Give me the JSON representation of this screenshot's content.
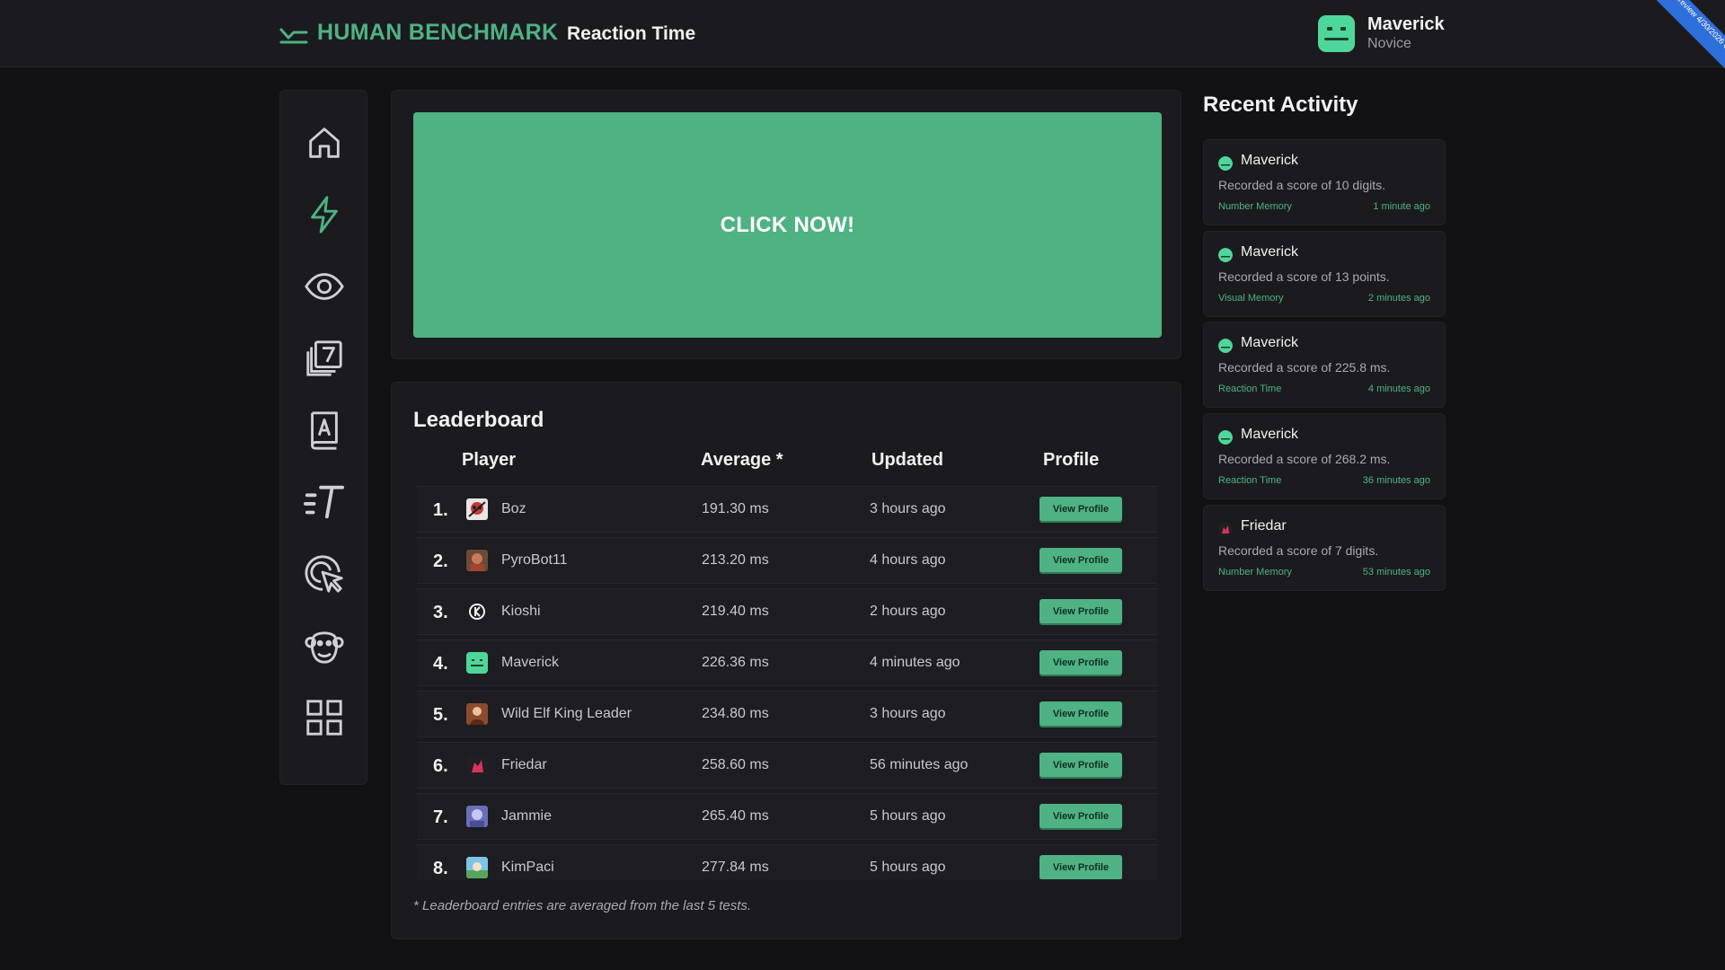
{
  "header": {
    "logo_text": "HUMAN BENCHMARK",
    "page_title": "Reaction Time",
    "user_name": "Maverick",
    "user_rank": "Novice",
    "ribbon_text": "dev preview 4/30/2026 0.1"
  },
  "nav": {
    "items": [
      "home-icon",
      "lightning-icon",
      "eye-icon",
      "number-memory-icon",
      "verbal-memory-icon",
      "typing-icon",
      "aim-icon",
      "chimp-icon",
      "grid-icon"
    ],
    "active_item": "lightning-icon"
  },
  "test": {
    "prompt": "CLICK NOW!"
  },
  "leaderboard": {
    "title": "Leaderboard",
    "columns": [
      "Player",
      "Average *",
      "Updated",
      "Profile"
    ],
    "button_label": "View Profile",
    "rows": [
      {
        "rank": "1.",
        "name": "Boz",
        "average": "191.30 ms",
        "updated": "3 hours ago"
      },
      {
        "rank": "2.",
        "name": "PyroBot11",
        "average": "213.20 ms",
        "updated": "4 hours ago"
      },
      {
        "rank": "3.",
        "name": "Kioshi",
        "average": "219.40 ms",
        "updated": "2 hours ago"
      },
      {
        "rank": "4.",
        "name": "Maverick",
        "average": "226.36 ms",
        "updated": "4 minutes ago"
      },
      {
        "rank": "5.",
        "name": "Wild Elf King Leader",
        "average": "234.80 ms",
        "updated": "3 hours ago"
      },
      {
        "rank": "6.",
        "name": "Friedar",
        "average": "258.60 ms",
        "updated": "56 minutes ago"
      },
      {
        "rank": "7.",
        "name": "Jammie",
        "average": "265.40 ms",
        "updated": "5 hours ago"
      },
      {
        "rank": "8.",
        "name": "KimPaci",
        "average": "277.84 ms",
        "updated": "5 hours ago"
      }
    ],
    "note": "* Leaderboard entries are averaged from the last 5 tests."
  },
  "activity": {
    "title": "Recent Activity",
    "items": [
      {
        "user": "Maverick",
        "text": "Recorded a score of 10 digits.",
        "test": "Number Memory",
        "time": "1 minute ago"
      },
      {
        "user": "Maverick",
        "text": "Recorded a score of 13 points.",
        "test": "Visual Memory",
        "time": "2 minutes ago"
      },
      {
        "user": "Maverick",
        "text": "Recorded a score of 225.8 ms.",
        "test": "Reaction Time",
        "time": "4 minutes ago"
      },
      {
        "user": "Maverick",
        "text": "Recorded a score of 268.2 ms.",
        "test": "Reaction Time",
        "time": "36 minutes ago"
      },
      {
        "user": "Friedar",
        "text": "Recorded a score of 7 digits.",
        "test": "Number Memory",
        "time": "53 minutes ago"
      }
    ]
  },
  "colors": {
    "accent": "#4fb283",
    "background": "#121215",
    "panel": "#1b1b1f"
  }
}
